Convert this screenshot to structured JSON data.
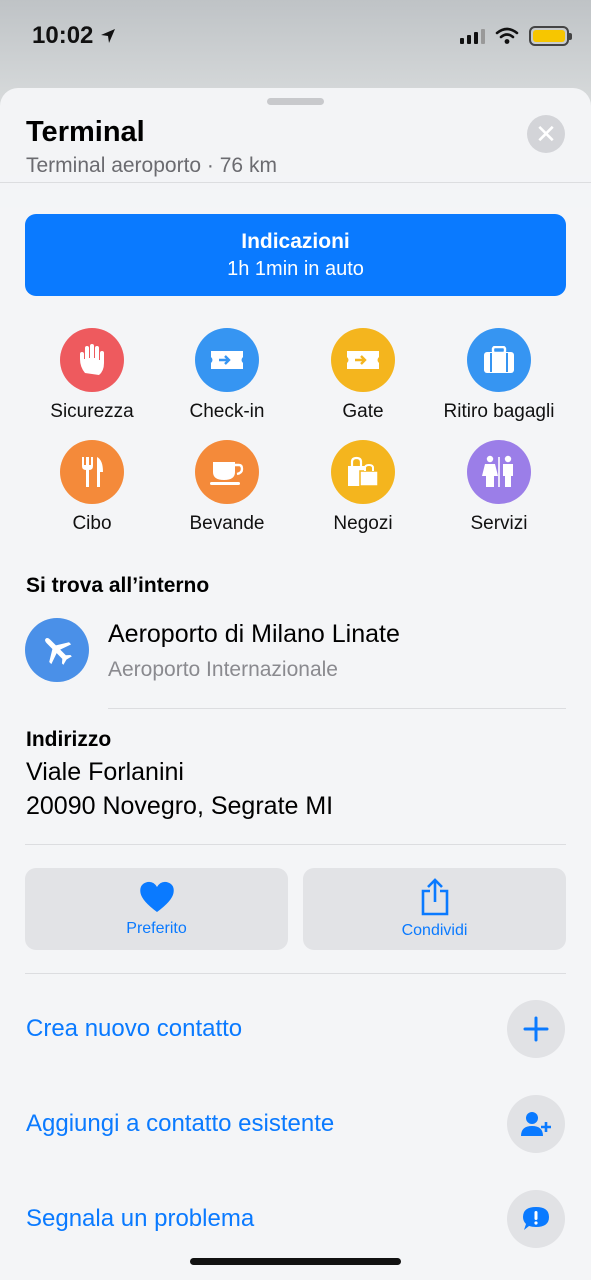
{
  "status": {
    "time": "10:02"
  },
  "header": {
    "title": "Terminal",
    "subtitle": "Terminal aeroporto · 76 km"
  },
  "directions": {
    "label": "Indicazioni",
    "eta": "1h 1min in auto"
  },
  "categories": [
    {
      "label": "Sicurezza",
      "color": "#ee5a5e",
      "icon": "hand-icon"
    },
    {
      "label": "Check-in",
      "color": "#3695f2",
      "icon": "ticket-icon"
    },
    {
      "label": "Gate",
      "color": "#f4b51e",
      "icon": "ticket-icon"
    },
    {
      "label": "Ritiro bagagli",
      "color": "#3695f2",
      "icon": "suitcase-icon"
    },
    {
      "label": "Cibo",
      "color": "#f48a3a",
      "icon": "fork-knife-icon"
    },
    {
      "label": "Bevande",
      "color": "#f48a3a",
      "icon": "cup-icon"
    },
    {
      "label": "Negozi",
      "color": "#f4b51e",
      "icon": "shopping-bags-icon"
    },
    {
      "label": "Servizi",
      "color": "#9b7ee8",
      "icon": "restroom-icon"
    }
  ],
  "inside": {
    "heading": "Si trova all’interno",
    "name": "Aeroporto di Milano Linate",
    "type": "Aeroporto Internazionale"
  },
  "address": {
    "heading": "Indirizzo",
    "line1": "Viale Forlanini",
    "line2": "20090 Novegro, Segrate MI"
  },
  "actions": {
    "favorite": "Preferito",
    "share": "Condividi"
  },
  "links": {
    "new_contact": "Crea nuovo contatto",
    "add_existing": "Aggiungi a contatto esistente",
    "report": "Segnala un problema"
  },
  "accent": "#0a7aff"
}
